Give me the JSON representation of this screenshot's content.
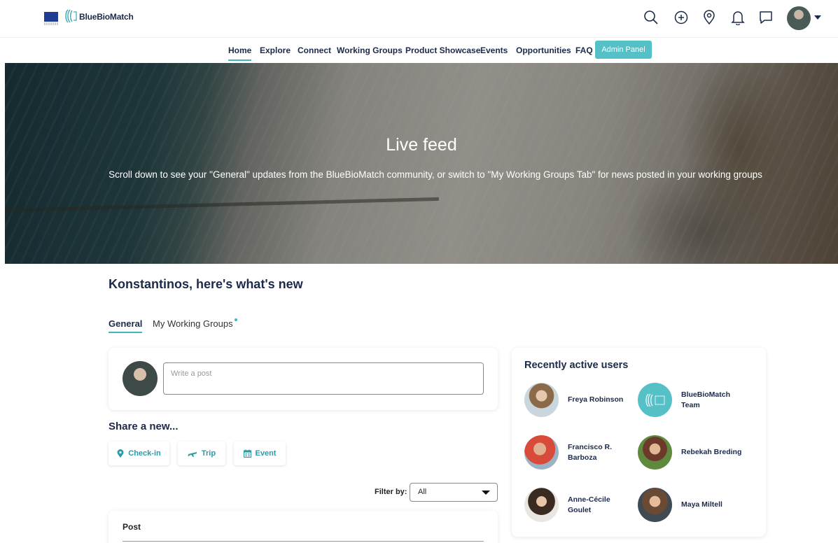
{
  "header": {
    "logo_text": "BlueBioMatch",
    "icons": [
      "search-icon",
      "plus-circle-icon",
      "location-pin-icon",
      "bell-icon",
      "chat-icon"
    ]
  },
  "nav": {
    "items": [
      {
        "label": "Home",
        "active": true
      },
      {
        "label": "Explore"
      },
      {
        "label": "Connect"
      },
      {
        "label": "Working Groups"
      },
      {
        "label": "Product Showcase"
      },
      {
        "label": "Events"
      },
      {
        "label": "Opportunities"
      },
      {
        "label": "FAQ"
      }
    ],
    "admin_label": "Admin Panel"
  },
  "hero": {
    "title": "Live feed",
    "subtitle": "Scroll down to see your \"General\" updates from the BlueBioMatch community, or switch to \"My Working Groups Tab\" for news posted in your working groups"
  },
  "main": {
    "greeting": "Konstantinos, here's what's new",
    "tabs": [
      {
        "label": "General",
        "active": true
      },
      {
        "label": "My Working Groups",
        "has_dot": true
      }
    ],
    "post_placeholder": "Write a post",
    "share_title": "Share a new...",
    "share_buttons": [
      {
        "label": "Check-in",
        "icon": "map-marker-icon"
      },
      {
        "label": "Trip",
        "icon": "plane-icon"
      },
      {
        "label": "Event",
        "icon": "calendar-icon"
      }
    ],
    "filter_label": "Filter by:",
    "filter_value": "All",
    "feed_first_label": "Post"
  },
  "recent_users": {
    "title": "Recently active users",
    "users": [
      {
        "name": "Freya Robinson"
      },
      {
        "name": "BlueBioMatch Team"
      },
      {
        "name": "Francisco R. Barboza"
      },
      {
        "name": "Rebekah Breding"
      },
      {
        "name": "Anne-Cécile Goulet"
      },
      {
        "name": "Maya Miltell"
      }
    ]
  },
  "colors": {
    "accent": "#43b5bd",
    "admin_button": "#56c0c7",
    "navy": "#1b2a4a"
  }
}
